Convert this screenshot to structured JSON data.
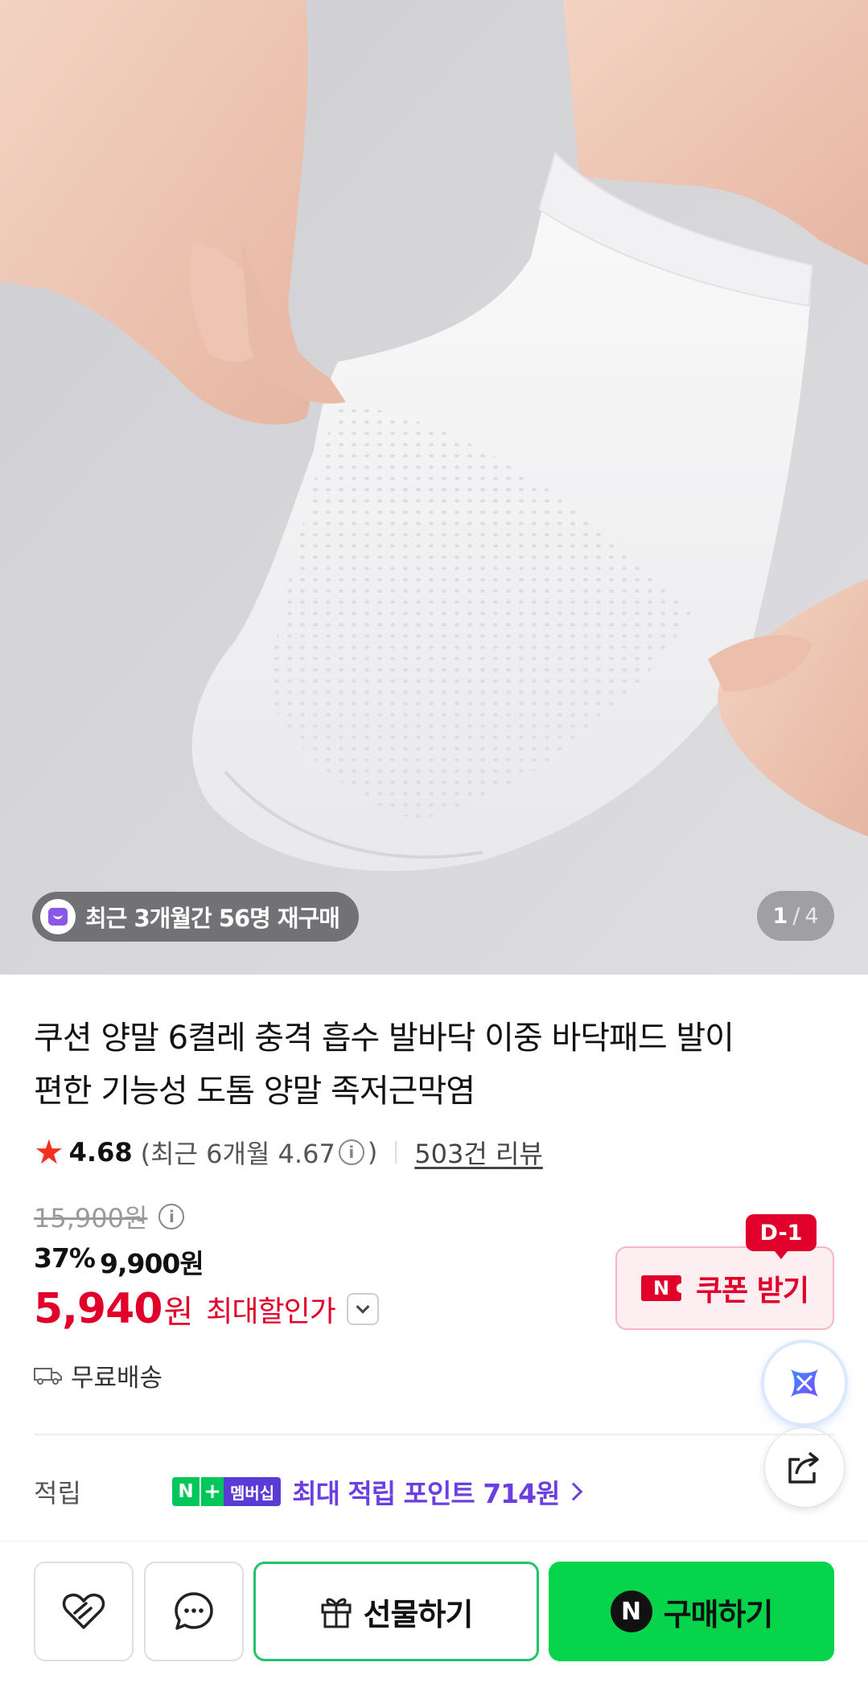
{
  "gallery": {
    "repurchase_text": "최근 3개월간 56명 재구매",
    "pager_current": "1",
    "pager_separator": "/",
    "pager_total": "4"
  },
  "product": {
    "title_line1": "쿠션 양말 6켤레 충격 흡수 발바닥 이중 바닥패드 발이",
    "title_line2": "편한 기능성 도톰 양말 족저근막염",
    "rating": "4.68",
    "recent_rating_prefix": "(최근 6개월 4.67",
    "recent_rating_suffix": ")",
    "review_count": "503건 리뷰",
    "original_price": "15,900원",
    "discount_rate": "37%",
    "sale_price": "9,900원",
    "final_price": "5,940",
    "final_price_unit": "원",
    "final_price_label": "최대할인가",
    "delivery": "무료배송"
  },
  "coupon": {
    "badge": "D-1",
    "label": "쿠폰 받기",
    "icon_text": "N"
  },
  "points": {
    "label": "적립",
    "badge_n": "N",
    "badge_plus": "+",
    "badge_membership": "멤버십",
    "text": "최대 적립 포인트 714원"
  },
  "bottom_bar": {
    "gift_label": "선물하기",
    "buy_label": "구매하기",
    "buy_icon_text": "N"
  },
  "colors": {
    "accent_red": "#e0002a",
    "naver_green": "#06d44a",
    "membership_purple": "#6b3fe0"
  }
}
